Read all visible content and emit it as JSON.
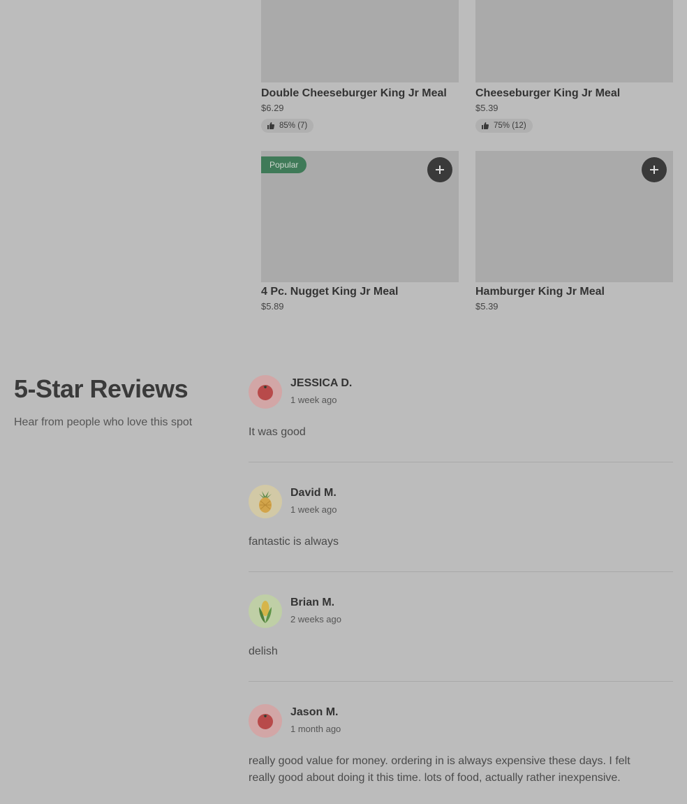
{
  "menu_items": [
    {
      "title": "Double Cheeseburger King Jr Meal",
      "price": "$6.29",
      "rating": "85% (7)"
    },
    {
      "title": "Cheeseburger King Jr Meal",
      "price": "$5.39",
      "rating": "75% (12)"
    },
    {
      "title": "4 Pc. Nugget King Jr Meal",
      "price": "$5.89",
      "badge": "Popular"
    },
    {
      "title": "Hamburger King Jr Meal",
      "price": "$5.39"
    }
  ],
  "reviews_section": {
    "title": "5-Star Reviews",
    "subtitle": "Hear from people who love this spot"
  },
  "reviews": [
    {
      "name": "JESSICA D.",
      "time": "1 week ago",
      "text": "It was good",
      "avatar_icon": "tomato-icon"
    },
    {
      "name": "David M.",
      "time": "1 week ago",
      "text": "fantastic is always",
      "avatar_icon": "pineapple-icon"
    },
    {
      "name": "Brian M.",
      "time": "2 weeks ago",
      "text": "delish",
      "avatar_icon": "corn-icon"
    },
    {
      "name": "Jason M.",
      "time": "1 month ago",
      "text": "really good value for money. ordering in is always expensive these days. I felt really good about doing it this time. lots of food, actually rather inexpensive.",
      "avatar_icon": "tomato-icon"
    }
  ],
  "colors": {
    "background": "#bcbcbc",
    "popular_badge": "#3f7a58",
    "add_button": "#3a3a3a"
  }
}
